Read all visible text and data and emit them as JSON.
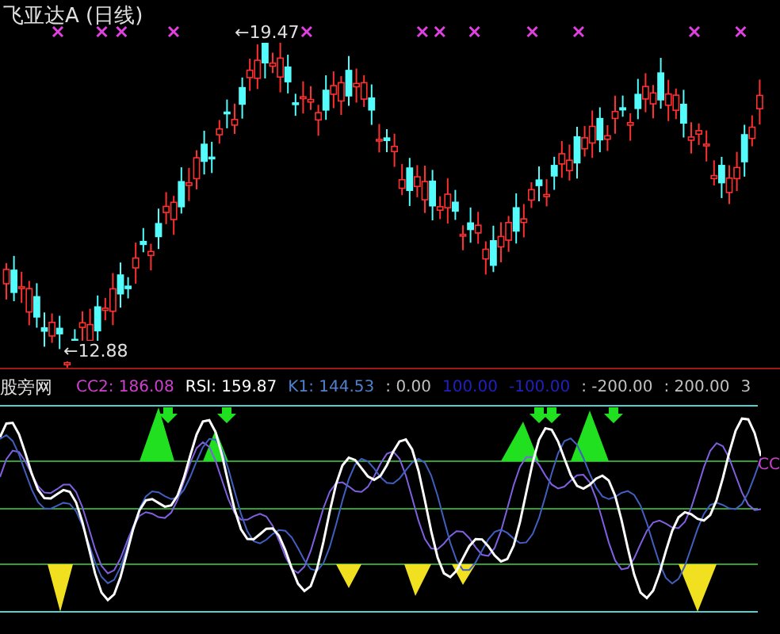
{
  "chart_title": "飞亚达A (日线)",
  "price_high": "←19.47",
  "price_low": "←12.88",
  "indicator": {
    "name": "股旁网",
    "legend": [
      {
        "text": "CC2: 186.08",
        "color": "#d040d0"
      },
      {
        "text": "RSI: 159.87",
        "color": "#ffffff"
      },
      {
        "text": "K1: 144.53",
        "color": "#5080d0"
      },
      {
        "text": ": 0.00",
        "color": "#c0c0c0"
      },
      {
        "text": "100.00",
        "color": "#2020c0"
      },
      {
        "text": "-100.00",
        "color": "#2020c0"
      },
      {
        "text": ": -200.00",
        "color": "#c0c0c0"
      },
      {
        "text": ": 200.00",
        "color": "#c0c0c0"
      },
      {
        "text": "3",
        "color": "#c0c0c0"
      }
    ],
    "side_label": "CC"
  }
}
